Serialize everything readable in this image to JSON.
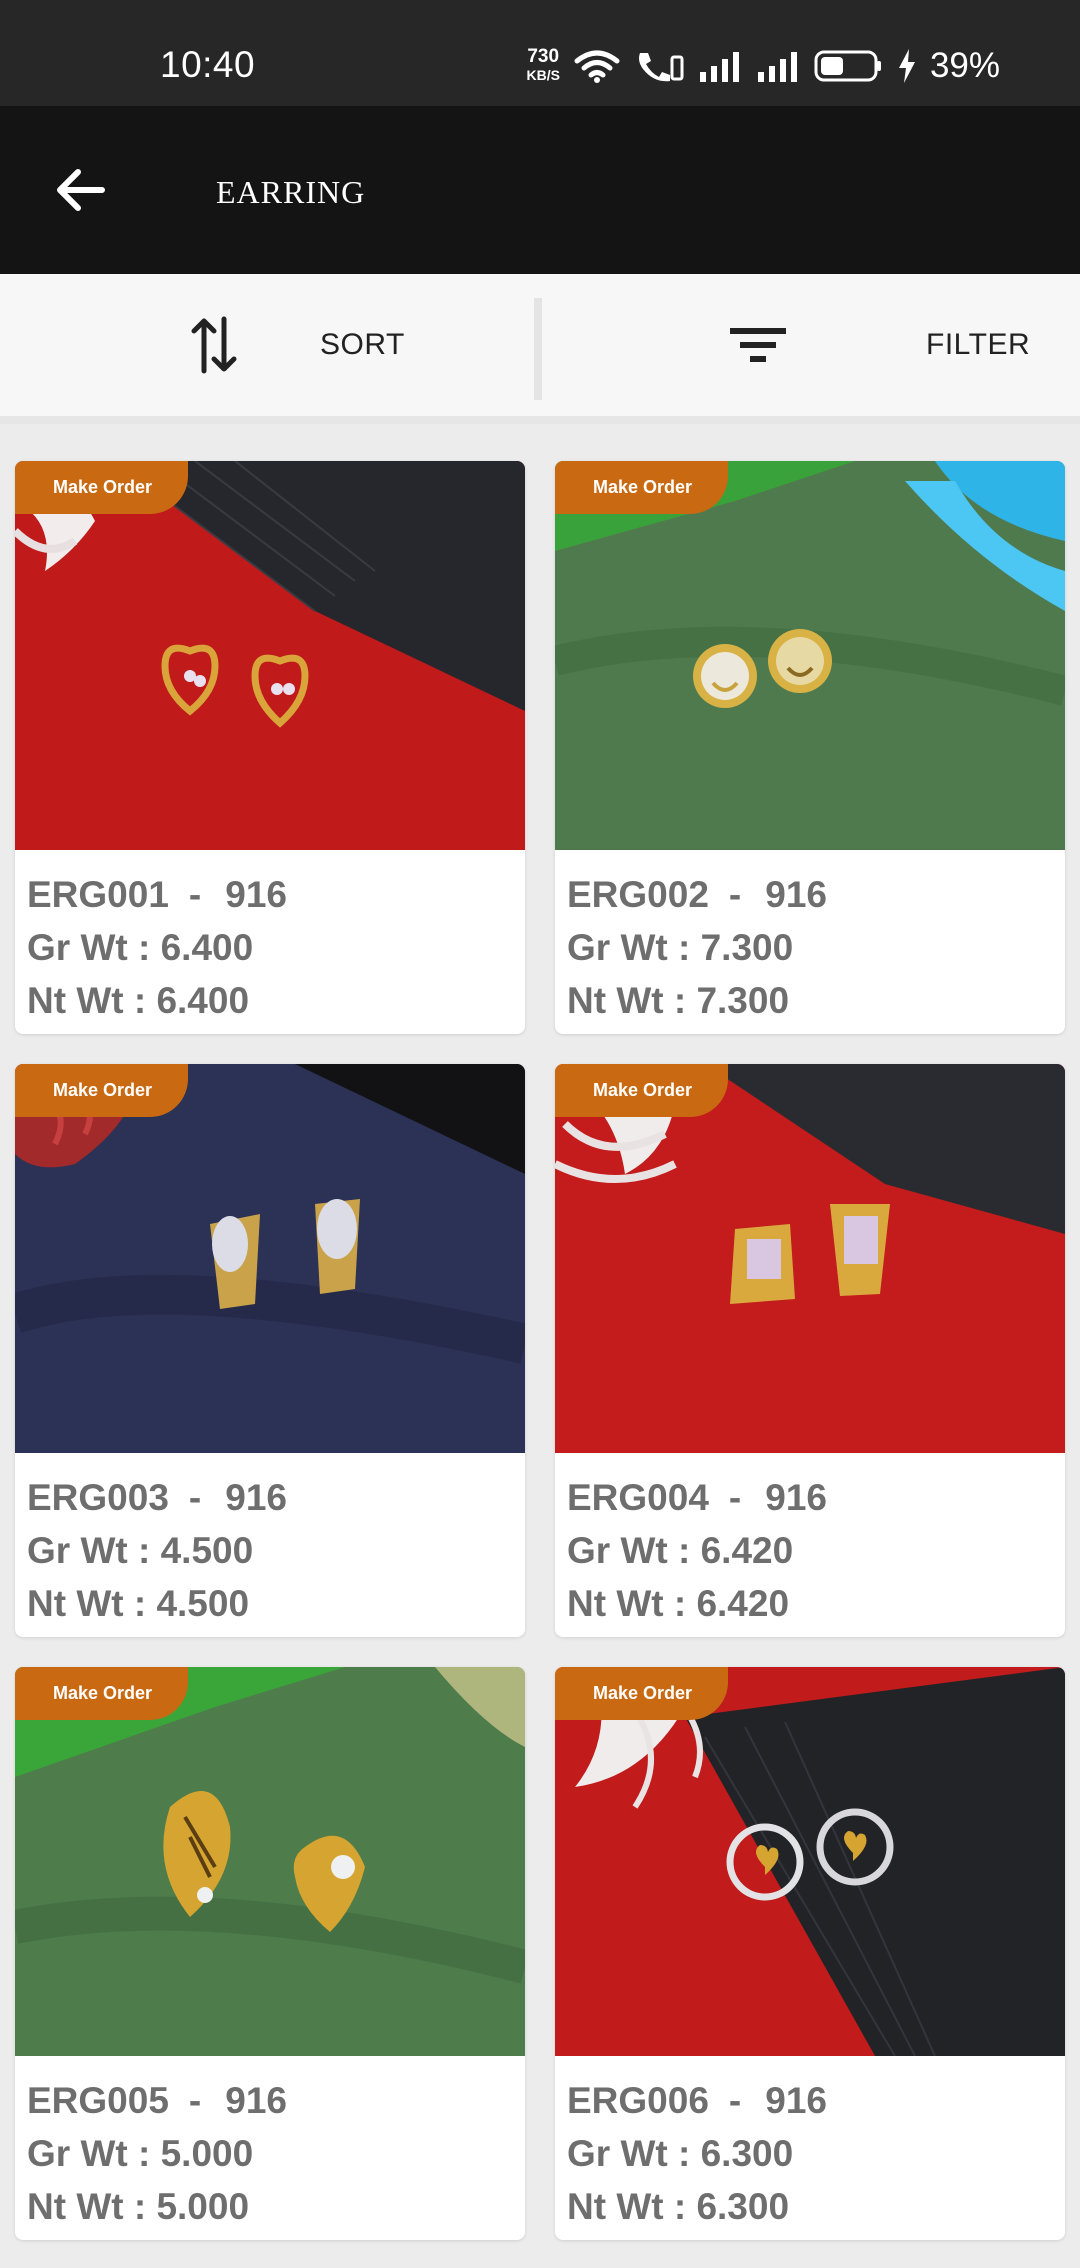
{
  "status": {
    "time": "10:40",
    "net_speed": "730",
    "net_unit": "KB/S",
    "battery": "39%"
  },
  "header": {
    "title": "EARRING"
  },
  "actions": {
    "sort_label": "SORT",
    "filter_label": "FILTER"
  },
  "colors": {
    "badge": "#c96a12",
    "app_bar": "#141414",
    "status_bar": "#272727"
  },
  "products": [
    {
      "badge": "Make Order",
      "code": "ERG001",
      "purity": "916",
      "gross": "Gr Wt : 6.400",
      "net": "Nt Wt : 6.400",
      "scene": "red-cloth-black-card",
      "design": "heart earrings"
    },
    {
      "badge": "Make Order",
      "code": "ERG002",
      "purity": "916",
      "gross": "Gr Wt : 7.300",
      "net": "Nt Wt : 7.300",
      "scene": "green-cloth-blue-feather",
      "design": "smiley earrings"
    },
    {
      "badge": "Make Order",
      "code": "ERG003",
      "purity": "916",
      "gross": "Gr Wt : 4.500",
      "net": "Nt Wt : 4.500",
      "scene": "navy-cloth-red-thread",
      "design": "oval stud earrings"
    },
    {
      "badge": "Make Order",
      "code": "ERG004",
      "purity": "916",
      "gross": "Gr Wt : 6.420",
      "net": "Nt Wt : 6.420",
      "scene": "red-cloth-white-thread",
      "design": "trapezoid earrings"
    },
    {
      "badge": "Make Order",
      "code": "ERG005",
      "purity": "916",
      "gross": "Gr Wt : 5.000",
      "net": "Nt Wt : 5.000",
      "scene": "green-cloth",
      "design": "leaf earrings"
    },
    {
      "badge": "Make Order",
      "code": "ERG006",
      "purity": "916",
      "gross": "Gr Wt : 6.300",
      "net": "Nt Wt : 6.300",
      "scene": "red-cloth-black-card",
      "design": "ring heart earrings"
    }
  ]
}
